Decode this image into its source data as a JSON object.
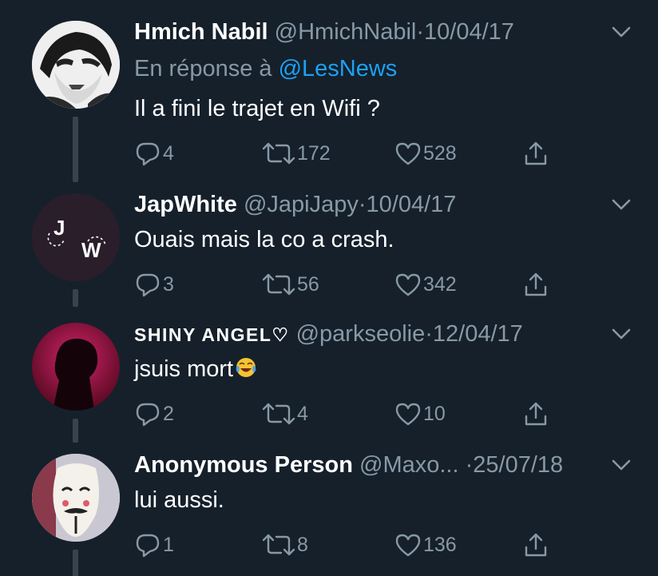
{
  "tweets": [
    {
      "name": "Hmich Nabil",
      "handle": "@HmichNabil",
      "separator": "·",
      "date": "10/04/17",
      "reply_prefix": "En réponse à",
      "reply_mention": "@LesNews",
      "text": "Il a fini le trajet en Wifi ?",
      "replies": "4",
      "retweets": "172",
      "likes": "528"
    },
    {
      "name": "JapWhite",
      "handle": "@JapiJapy",
      "separator": "·",
      "date": "10/04/17",
      "text": "Ouais mais la co a crash.",
      "replies": "3",
      "retweets": "56",
      "likes": "342"
    },
    {
      "name": "SHINY ANGEL♡",
      "handle": "@parkseolie",
      "separator": "·",
      "date": "12/04/17",
      "text": "jsuis mort",
      "emoji": "face-with-tears-of-joy",
      "replies": "2",
      "retweets": "4",
      "likes": "10"
    },
    {
      "name": "Anonymous Person",
      "handle": "@Maxo...",
      "separator": "·",
      "date": "25/07/18",
      "text": "lui aussi.",
      "replies": "1",
      "retweets": "8",
      "likes": "136"
    }
  ],
  "icons": {
    "reply": "reply-icon",
    "retweet": "retweet-icon",
    "like": "heart-icon",
    "share": "share-icon",
    "menu": "chevron-down-icon"
  },
  "colors": {
    "background": "#15202b",
    "text": "#ffffff",
    "secondary": "#8899a6",
    "link": "#1da1f2",
    "thread_line": "#38444d"
  }
}
